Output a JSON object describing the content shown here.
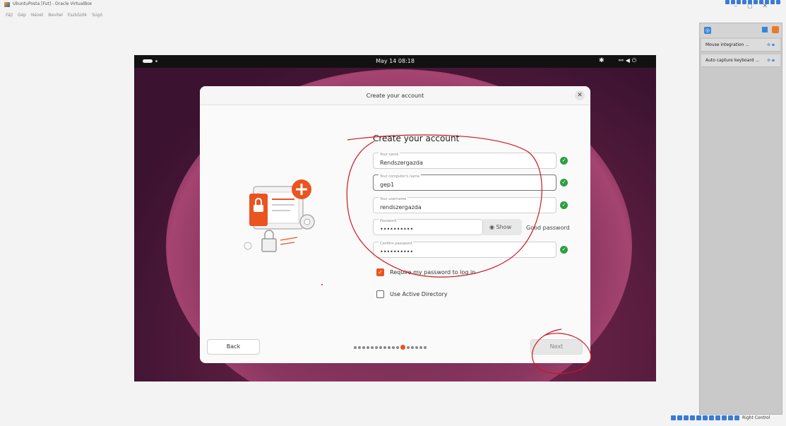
{
  "host": {
    "window_title": "UbuntuPosta [Fut] - Oracle VirtualBox",
    "menu": [
      "Fájl",
      "Gép",
      "Nézet",
      "Bevitel",
      "Eszközök",
      "Súgó"
    ],
    "host_key": "Right Control"
  },
  "side_panel": {
    "notifications": [
      {
        "label": "Mouse integration ..."
      },
      {
        "label": "Auto capture keyboard ..."
      }
    ]
  },
  "guest": {
    "clock": "May 14  08:18",
    "dialog": {
      "title": "Create your account",
      "form_title": "Create your account",
      "fields": {
        "name": {
          "label": "Your name",
          "value": "Rendszergazda"
        },
        "computer": {
          "label": "Your computer's name",
          "value": "gep1"
        },
        "username": {
          "label": "Your username",
          "value": "rendszergazda"
        },
        "password": {
          "label": "Password",
          "value": "••••••••••"
        },
        "confirm": {
          "label": "Confirm password",
          "value": "••••••••••"
        }
      },
      "show_label": "Show",
      "strength": "Good password",
      "require_password": {
        "label": "Require my password to log in",
        "checked": true
      },
      "active_directory": {
        "label": "Use Active Directory",
        "checked": false
      },
      "back": "Back",
      "next": "Next",
      "progress": {
        "total_steps": 17,
        "current_step": 12
      }
    }
  },
  "colors": {
    "accent": "#e95420",
    "annotation": "#d0161b",
    "ok": "#2f9e44"
  }
}
